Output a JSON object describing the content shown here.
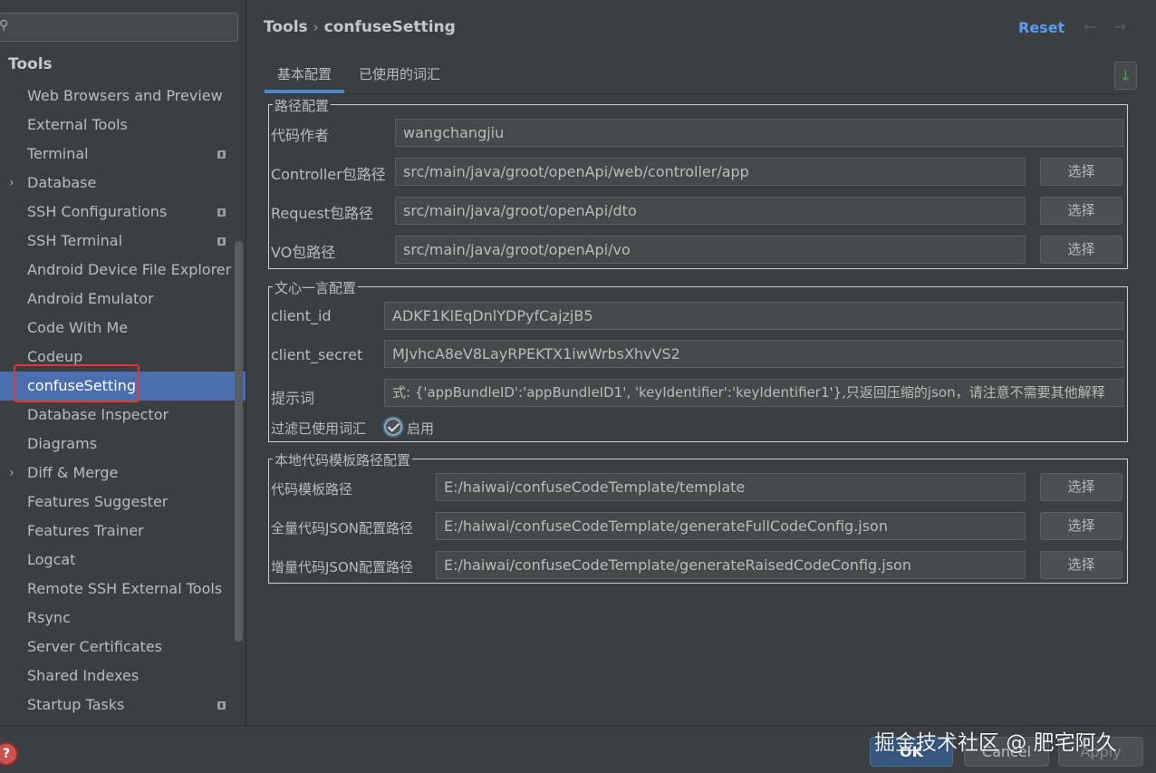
{
  "sidebar": {
    "search_icon": "search-icon",
    "root": "Tools",
    "items": [
      {
        "label": "Web Browsers and Preview"
      },
      {
        "label": "External Tools"
      },
      {
        "label": "Terminal"
      },
      {
        "label": "Database"
      },
      {
        "label": "SSH Configurations"
      },
      {
        "label": "SSH Terminal"
      },
      {
        "label": "Android Device File Explorer"
      },
      {
        "label": "Android Emulator"
      },
      {
        "label": "Code With Me"
      },
      {
        "label": "Codeup"
      },
      {
        "label": "confuseSetting"
      },
      {
        "label": "Database Inspector"
      },
      {
        "label": "Diagrams"
      },
      {
        "label": "Diff & Merge"
      },
      {
        "label": "Features Suggester"
      },
      {
        "label": "Features Trainer"
      },
      {
        "label": "Logcat"
      },
      {
        "label": "Remote SSH External Tools"
      },
      {
        "label": "Rsync"
      },
      {
        "label": "Server Certificates"
      },
      {
        "label": "Shared Indexes"
      },
      {
        "label": "Startup Tasks"
      }
    ]
  },
  "header": {
    "crumb_parent": "Tools",
    "crumb_sep": "›",
    "crumb_current": "confuseSetting",
    "reset": "Reset",
    "back": "←",
    "forward": "→"
  },
  "tabs": [
    {
      "label": "基本配置"
    },
    {
      "label": "已使用的词汇"
    }
  ],
  "download_icon": "↓",
  "path_group": {
    "title": "路径配置",
    "author_label": "代码作者",
    "author_value": "wangchangjiu",
    "controller_label": "Controller包路径",
    "controller_value": "src/main/java/groot/openApi/web/controller/app",
    "request_label": "Request包路径",
    "request_value": "src/main/java/groot/openApi/dto",
    "vo_label": "VO包路径",
    "vo_value": "src/main/java/groot/openApi/vo",
    "choose": "选择"
  },
  "ernie_group": {
    "title": "文心一言配置",
    "client_id_label": "client_id",
    "client_id_value": "ADKF1KlEqDnlYDPyfCajzjB5",
    "client_secret_label": "client_secret",
    "client_secret_value": "MJvhcA8eV8LayRPEKTX1iwWrbsXhvVS2",
    "prompt_label": "提示词",
    "prompt_value": "式: {'appBundleID':'appBundleID1', 'keyIdentifier':'keyIdentifier1'},只返回压缩的json，请注意不需要其他解释",
    "filter_label": "过滤已使用词汇",
    "filter_checked": true,
    "enable_label": "启用"
  },
  "template_group": {
    "title": "本地代码模板路径配置",
    "template_label": "代码模板路径",
    "template_value": "E:/haiwai/confuseCodeTemplate/template",
    "full_label": "全量代码JSON配置路径",
    "full_value": "E:/haiwai/confuseCodeTemplate/generateFullCodeConfig.json",
    "raised_label": "增量代码JSON配置路径",
    "raised_value": "E:/haiwai/confuseCodeTemplate/generateRaisedCodeConfig.json",
    "choose": "选择"
  },
  "footer": {
    "help": "?",
    "ok": "OK",
    "cancel": "Cancel",
    "apply": "Apply"
  },
  "watermark": "掘金技术社区 @ 肥宅阿久",
  "colors": {
    "accent": "#4b6eaf",
    "link": "#589df6",
    "highlight": "#e0373a"
  }
}
